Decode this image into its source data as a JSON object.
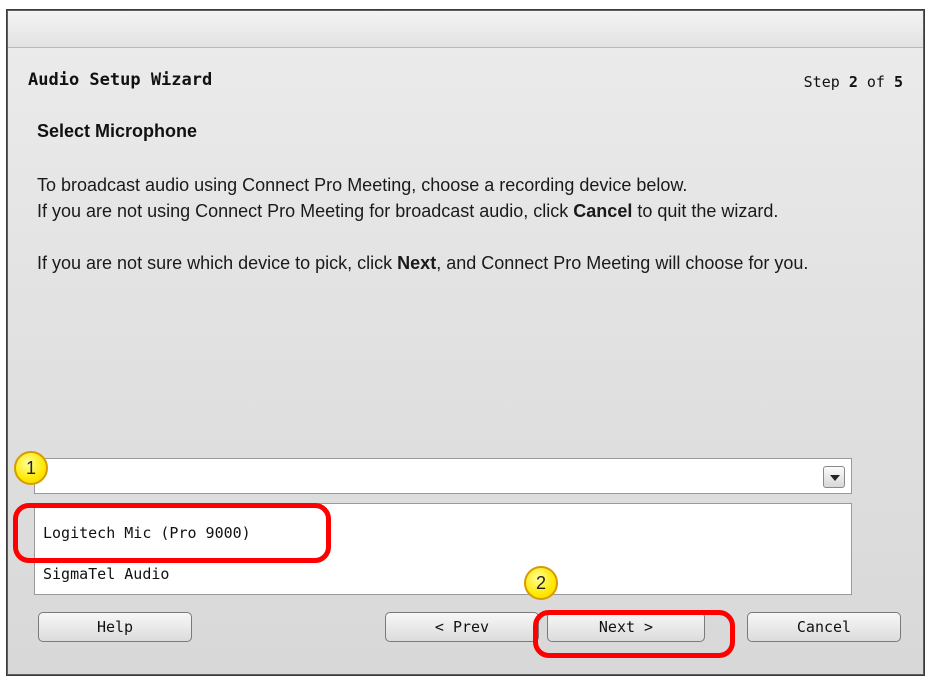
{
  "dialog": {
    "title": "Audio Setup Wizard",
    "step": {
      "prefix": "Step",
      "current": "2",
      "of": "of",
      "total": "5"
    },
    "section_title": "Select Microphone",
    "paragraphs": {
      "p1": "To broadcast audio using Connect Pro Meeting, choose a recording device below.",
      "p2_before": "If you are not using Connect Pro Meeting for broadcast audio, click ",
      "p2_bold": "Cancel",
      "p2_after": " to quit the wizard.",
      "p3_before": "If you are not sure which device to pick, click ",
      "p3_bold": "Next",
      "p3_after": ", and Connect Pro Meeting will choose for you."
    }
  },
  "microphone_select": {
    "selected_value": "",
    "options": [
      "Logitech Mic (Pro 9000)",
      "SigmaTel Audio"
    ]
  },
  "buttons": {
    "help": "Help",
    "prev": "< Prev",
    "next": "Next >",
    "cancel": "Cancel"
  },
  "annotations": {
    "callout_1": "1",
    "callout_2": "2",
    "highlight_color": "#ff0000",
    "callout_color": "#ffe800"
  },
  "icons": {
    "dropdown": "chevron-down-icon"
  }
}
